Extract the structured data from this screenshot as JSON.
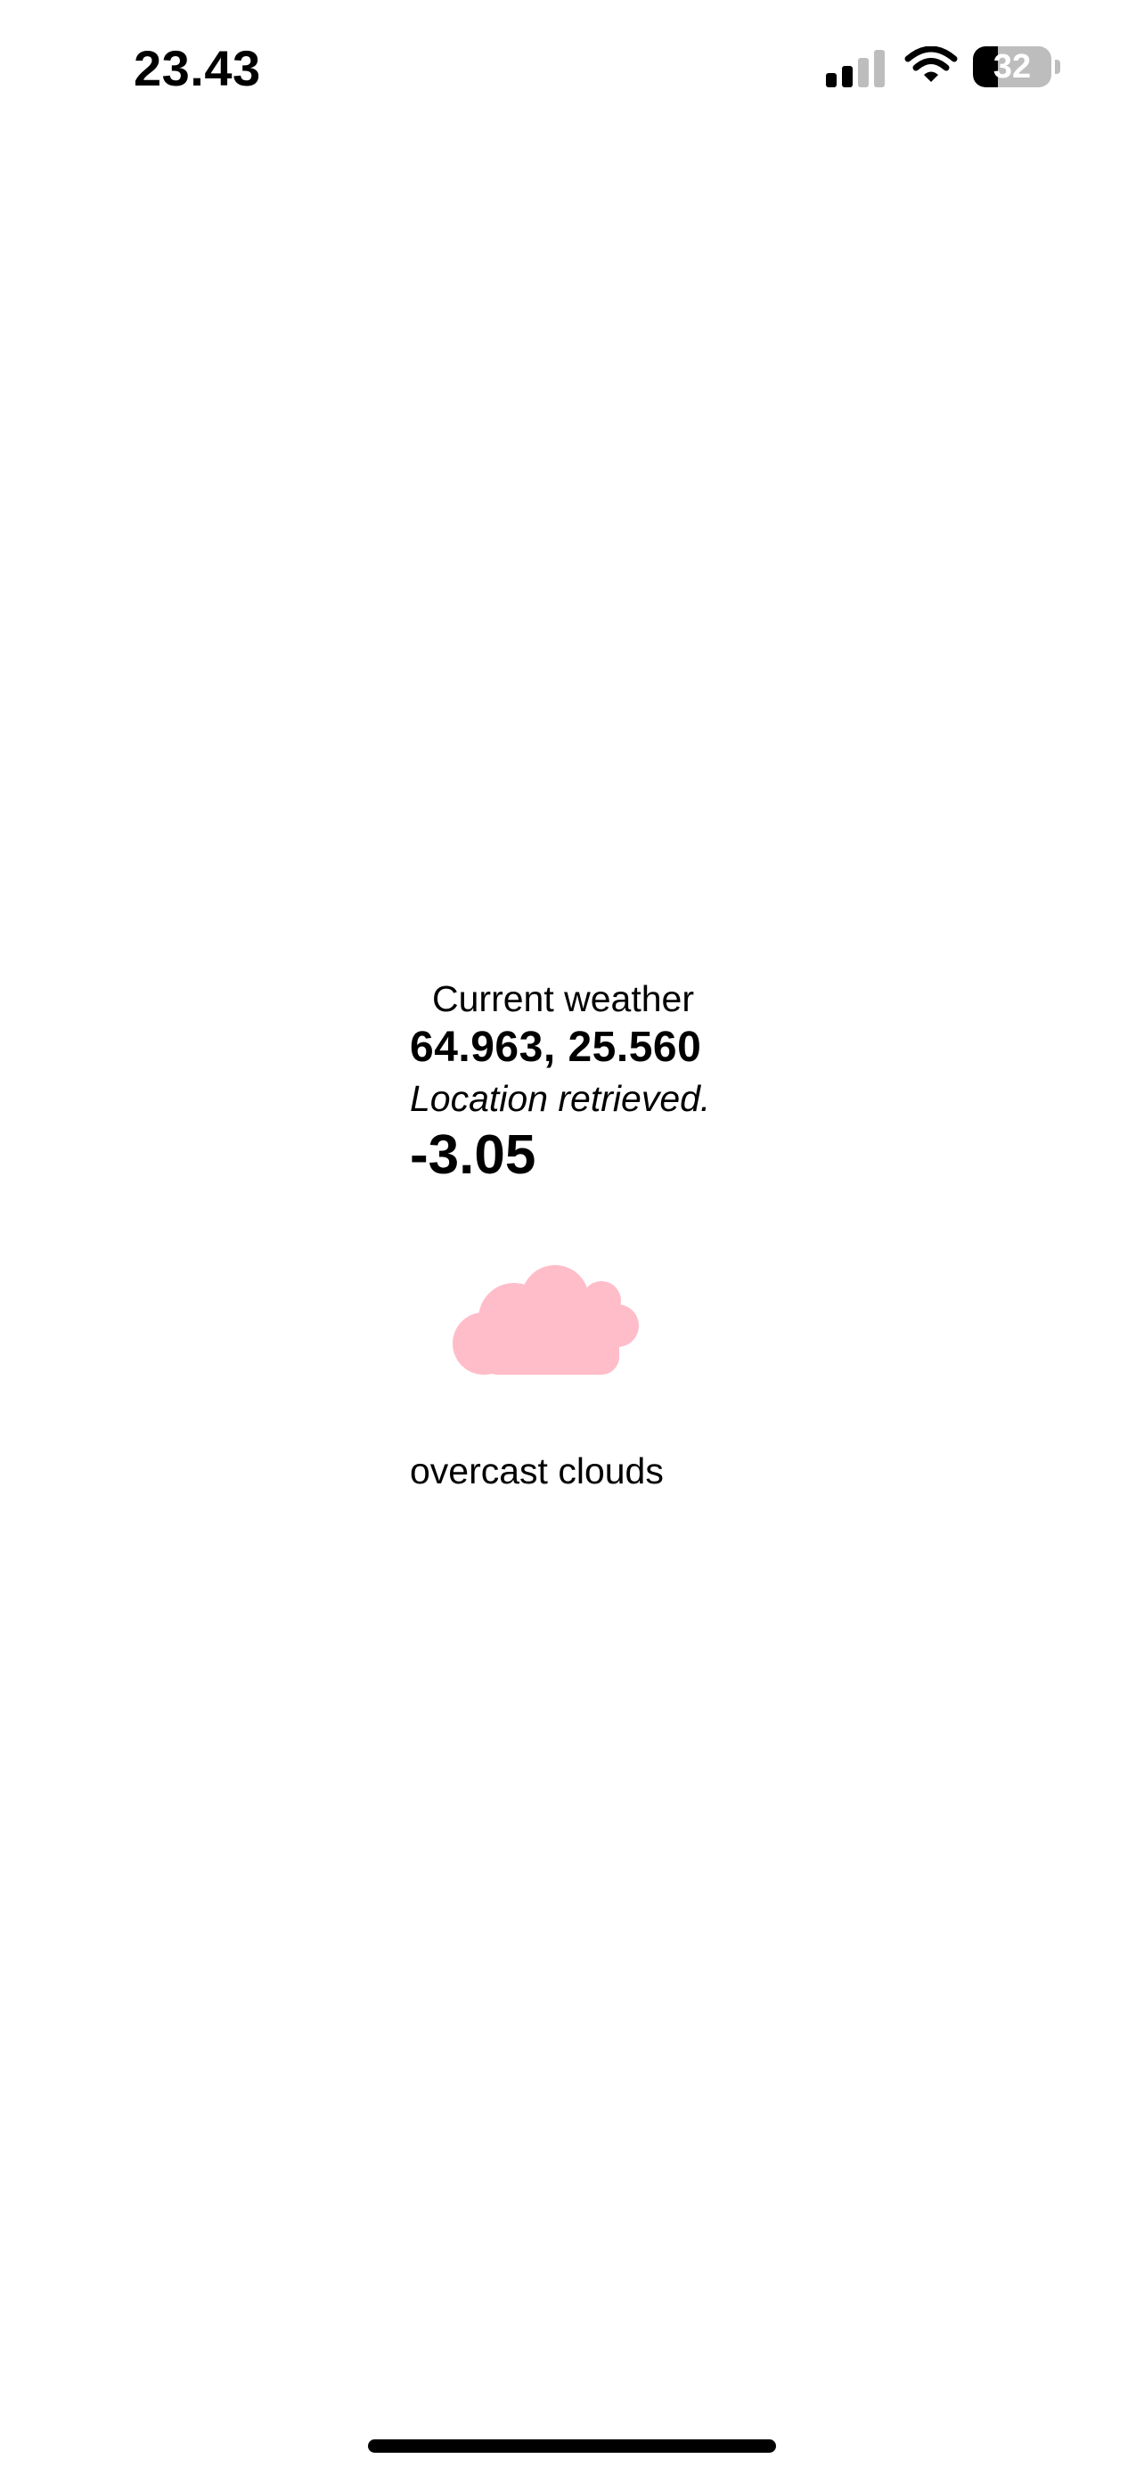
{
  "status_bar": {
    "time": "23.43",
    "signal_icon": "cellular-signal-icon",
    "signal_bars_active": 2,
    "signal_bars_total": 4,
    "wifi_icon": "wifi-icon",
    "battery_percent": "32",
    "battery_level": 0.32
  },
  "weather": {
    "heading": "Current weather",
    "coordinates": "64.963, 25.560",
    "location_status": "Location retrieved.",
    "temperature": "-3.05",
    "condition_icon": "cloud-icon",
    "condition_icon_color": "#FFBDC9",
    "description": "overcast clouds"
  },
  "colors": {
    "background": "#FFFFFF",
    "text": "#000000",
    "inactive_signal": "#BDBDBD"
  }
}
